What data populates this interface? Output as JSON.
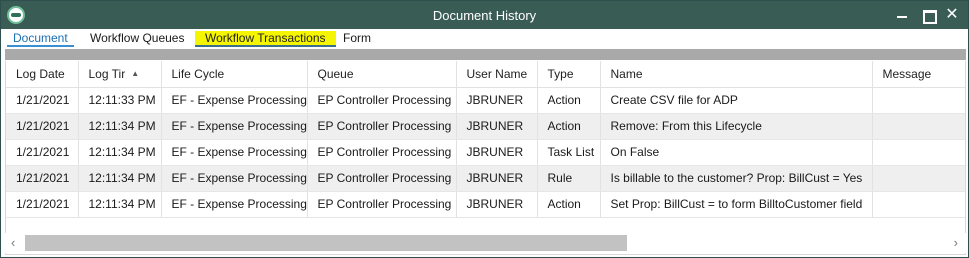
{
  "window": {
    "title": "Document History"
  },
  "tabs": [
    {
      "label": "Document"
    },
    {
      "label": "Workflow Queues"
    },
    {
      "label": "Workflow Transactions"
    },
    {
      "label": "Form"
    }
  ],
  "grid": {
    "columns": [
      "Log Date",
      "Log Tir",
      "Life Cycle",
      "Queue",
      "User Name",
      "Type",
      "Name",
      "Message"
    ],
    "rows": [
      [
        "1/21/2021",
        "12:11:33 PM",
        "EF - Expense Processing",
        "EP Controller Processing",
        "JBRUNER",
        "Action",
        "Create CSV file for ADP",
        ""
      ],
      [
        "1/21/2021",
        "12:11:34 PM",
        "EF - Expense Processing",
        "EP Controller Processing",
        "JBRUNER",
        "Action",
        "Remove: From this Lifecycle",
        ""
      ],
      [
        "1/21/2021",
        "12:11:34 PM",
        "EF - Expense Processing",
        "EP Controller Processing",
        "JBRUNER",
        "Task List",
        "On False",
        ""
      ],
      [
        "1/21/2021",
        "12:11:34 PM",
        "EF - Expense Processing",
        "EP Controller Processing",
        "JBRUNER",
        "Rule",
        "Is billable to the customer? Prop: BillCust = Yes",
        ""
      ],
      [
        "1/21/2021",
        "12:11:34 PM",
        "EF - Expense Processing",
        "EP Controller Processing",
        "JBRUNER",
        "Action",
        "Set Prop: BillCust = to form BilltoCustomer field",
        ""
      ]
    ]
  },
  "colors": {
    "titlebar": "#395c55",
    "tab_highlight": "#f5f500",
    "active_tab_underline": "#3a8fd0"
  }
}
